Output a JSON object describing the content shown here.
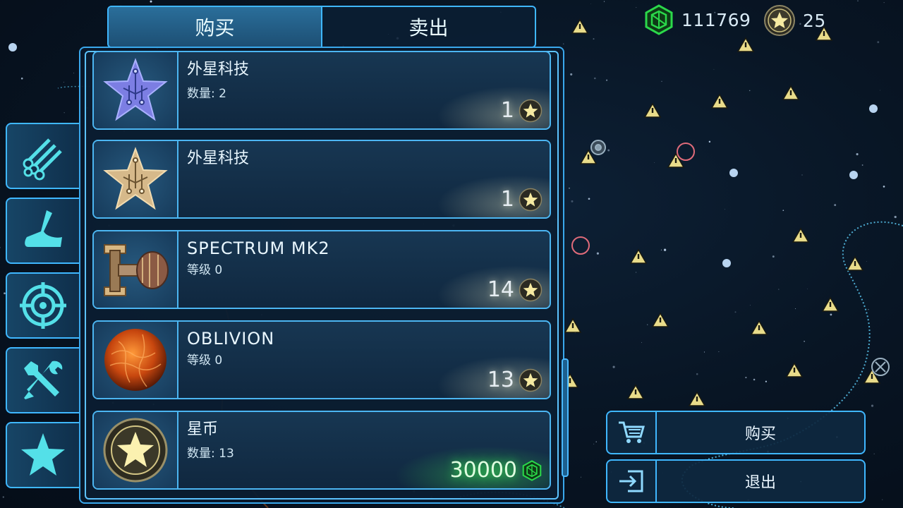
{
  "currency": {
    "gems": "111769",
    "stars": "25"
  },
  "tabs": [
    {
      "label": "购买",
      "active": true
    },
    {
      "label": "卖出",
      "active": false
    }
  ],
  "categories": [
    {
      "name": "materials",
      "icon": "pipes-icon"
    },
    {
      "name": "hulls",
      "icon": "ship-hull-icon"
    },
    {
      "name": "weapons",
      "icon": "crosshair-icon"
    },
    {
      "name": "tools",
      "icon": "wrench-screwdriver-icon"
    },
    {
      "name": "special",
      "icon": "star-icon"
    }
  ],
  "items": [
    {
      "title": "外星科技",
      "sub": "数量: 2",
      "price": "1",
      "currency": "star",
      "thumb": "purple-circuit-star-icon"
    },
    {
      "title": "外星科技",
      "sub": "",
      "price": "1",
      "currency": "star",
      "thumb": "gold-circuit-star-icon"
    },
    {
      "title": "SPECTRUM MK2",
      "sub": "等级 0",
      "price": "14",
      "currency": "star",
      "thumb": "ship-module-icon"
    },
    {
      "title": "OBLIVION",
      "sub": "等级 0",
      "price": "13",
      "currency": "star",
      "thumb": "orange-sphere-icon"
    },
    {
      "title": "星币",
      "sub": "数量: 13",
      "price": "30000",
      "currency": "gem",
      "thumb": "star-coin-icon"
    }
  ],
  "actions": {
    "buy_label": "购买",
    "exit_label": "退出"
  },
  "colors": {
    "accent": "#3fb7ff",
    "gem": "#2bd84a",
    "star": "#f3e9a6"
  }
}
